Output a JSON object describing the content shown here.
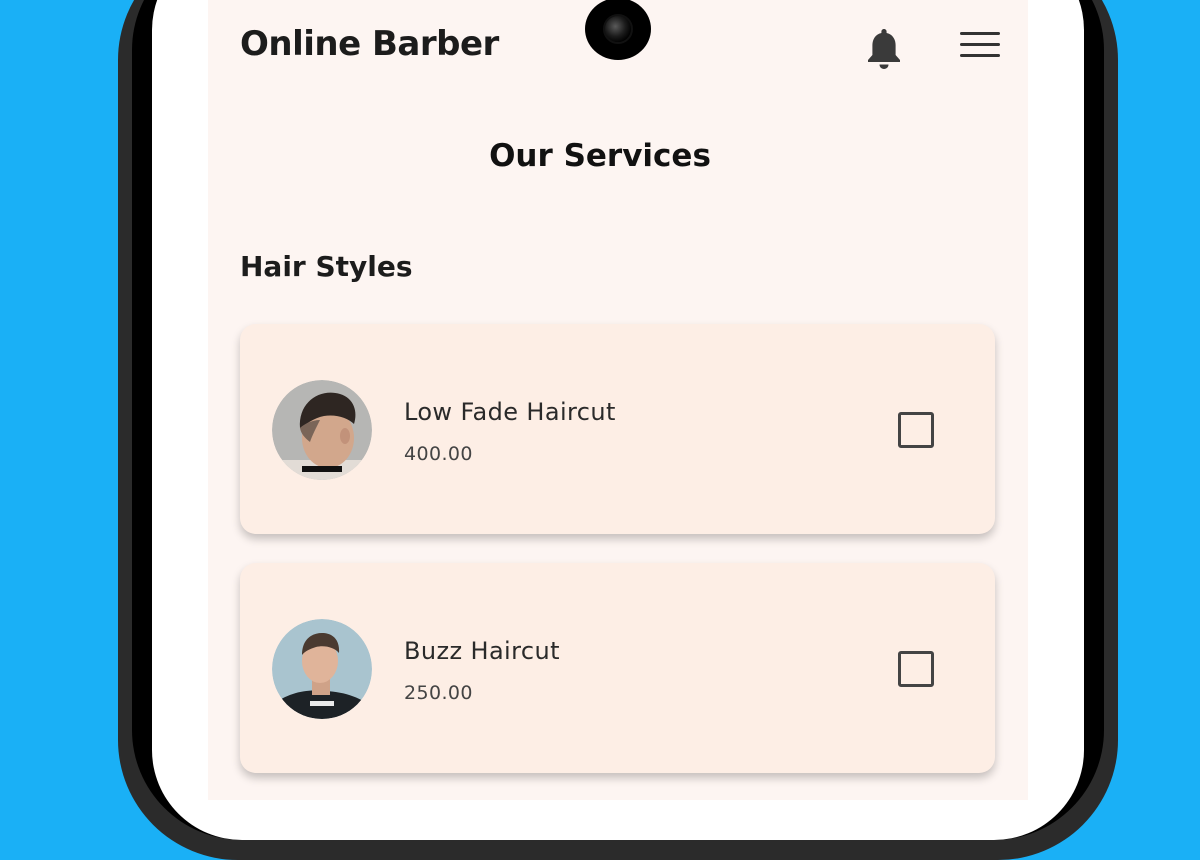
{
  "app": {
    "title": "Online Barber"
  },
  "icons": {
    "notifications": "bell-icon",
    "menu": "hamburger-menu-icon"
  },
  "page": {
    "title": "Our Services"
  },
  "section": {
    "title": "Hair Styles"
  },
  "services": [
    {
      "name": "Low Fade Haircut",
      "price": "400.00",
      "checked": false,
      "image": "low-fade-haircut-photo"
    },
    {
      "name": "Buzz Haircut",
      "price": "250.00",
      "checked": false,
      "image": "buzz-haircut-photo"
    }
  ],
  "colors": {
    "background": "#1ab0f6",
    "app_background": "#fdf5f2",
    "card_background": "#fdeee5",
    "text_primary": "#1c1c1c"
  }
}
